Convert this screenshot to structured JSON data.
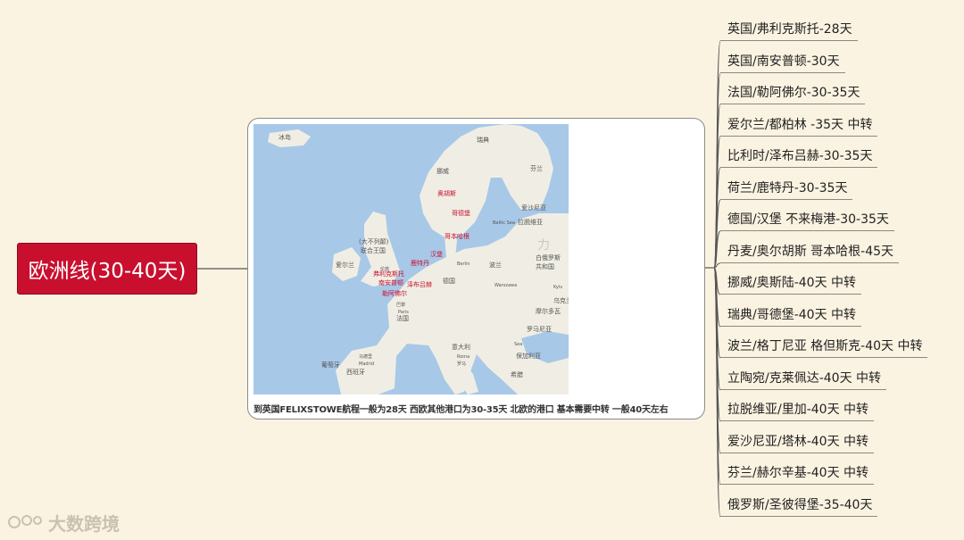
{
  "root": {
    "label": "欧洲线(30-40天)"
  },
  "caption": "到英国FELIXSTOWE航程一般为28天 西欧其他港口为30-35天 北欧的港口 基本需要中转 一般40天左右",
  "map": {
    "water_color": "#a8c8e8",
    "land_color": "#f0eee4",
    "ports": [
      "奥胡斯",
      "哥德堡",
      "哥本哈根",
      "汉堡",
      "鹿特丹",
      "泽布吕赫",
      "弗利克斯托",
      "南安普顿",
      "勒阿佛尔"
    ],
    "labels": [
      "冰岛",
      "挪威",
      "瑞典",
      "芬兰",
      "爱沙尼亚",
      "拉脱维亚",
      "白俄罗斯",
      "共和国",
      "乌克兰",
      "摩尔多瓦",
      "罗马尼亚",
      "保加利亚",
      "希腊",
      "意大利",
      "法国",
      "西班牙",
      "葡萄牙",
      "德国",
      "波兰",
      "爱尔兰",
      "(大不列颠)",
      "联合王国",
      "Berlin",
      "Warszawa",
      "Paris",
      "Madrid",
      "Roma",
      "Kyiv",
      "伦敦",
      "巴黎",
      "马德里",
      "罗马",
      "Baltic Sea",
      "Sea"
    ],
    "watermark": "力"
  },
  "branches": [
    {
      "label": "英国/弗利克斯托-28天"
    },
    {
      "label": "英国/南安普顿-30天"
    },
    {
      "label": "法国/勒阿佛尔-30-35天"
    },
    {
      "label": "爱尔兰/都柏林 -35天 中转"
    },
    {
      "label": "比利时/泽布吕赫-30-35天"
    },
    {
      "label": "荷兰/鹿特丹-30-35天"
    },
    {
      "label": "德国/汉堡 不来梅港-30-35天"
    },
    {
      "label": "丹麦/奥尔胡斯 哥本哈根-45天"
    },
    {
      "label": "挪威/奥斯陆-40天 中转"
    },
    {
      "label": "瑞典/哥德堡-40天 中转"
    },
    {
      "label": "波兰/格丁尼亚 格但斯克-40天 中转"
    },
    {
      "label": "立陶宛/克莱佩达-40天 中转"
    },
    {
      "label": "拉脱维亚/里加-40天 中转"
    },
    {
      "label": "爱沙尼亚/塔林-40天 中转"
    },
    {
      "label": "芬兰/赫尔辛基-40天 中转"
    },
    {
      "label": "俄罗斯/圣彼得堡-35-40天"
    }
  ],
  "watermark": {
    "text": "大数跨境"
  },
  "colors": {
    "background": "#fbf3e1",
    "root": "#c8102e",
    "connector": "#555555"
  }
}
